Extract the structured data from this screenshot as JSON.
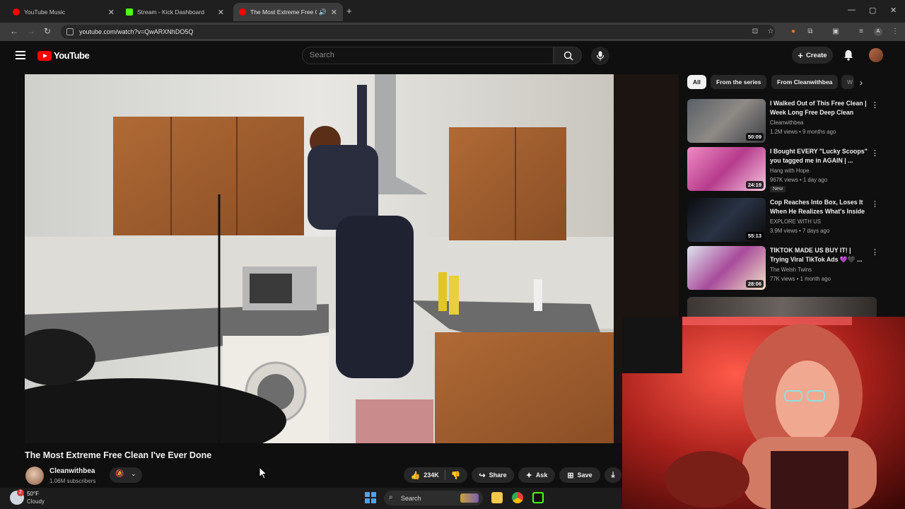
{
  "browser": {
    "tabs": [
      {
        "label": "YouTube Music",
        "favicon_color": "#ff0000"
      },
      {
        "label": "Stream - Kick Dashboard",
        "favicon_color": "#53fc18"
      },
      {
        "label": "The Most Extreme Free Clean",
        "favicon_color": "#ff0000",
        "active": true
      }
    ],
    "new_tab": "+",
    "url": "youtube.com/watch?v=QwARXNhDO5Q"
  },
  "youtube": {
    "logo_text": "YouTube",
    "search_placeholder": "Search",
    "create_label": "Create"
  },
  "video": {
    "title": "The Most Extreme Free Clean I've Ever Done",
    "channel": "Cleanwithbea",
    "subscribers": "1.06M subscribers",
    "likes": "234K",
    "share_label": "Share",
    "ask_label": "Ask",
    "save_label": "Save"
  },
  "sidebar": {
    "chips": [
      "All",
      "From the series",
      "From Cleanwithbea",
      "W"
    ],
    "recommendations": [
      {
        "title": "I Walked Out of This Free Clean | Week Long Free Deep Clean",
        "channel": "Cleanwithbea",
        "meta": "1.2M views • 9 months ago",
        "duration": "50:09"
      },
      {
        "title": "I Bought EVERY \"Lucky Scoops\" you tagged me in AGAIN | ...",
        "channel": "Hang with Hope",
        "meta": "967K views • 1 day ago",
        "duration": "24:19",
        "badge": "New"
      },
      {
        "title": "Cop Reaches Into Box, Loses It When He Realizes What's Inside",
        "channel": "EXPLORE WITH US",
        "meta": "3.9M views • 7 days ago",
        "duration": "55:13"
      },
      {
        "title": "TIKTOK MADE US BUY IT! | Trying Viral TikTok Ads 💜🖤 ...",
        "channel": "The Welsh Twins",
        "meta": "77K views • 1 month ago",
        "duration": "28:06"
      }
    ]
  },
  "taskbar": {
    "temperature": "50°F",
    "weather": "Cloudy",
    "search_label": "Search",
    "notification_count": "2"
  }
}
